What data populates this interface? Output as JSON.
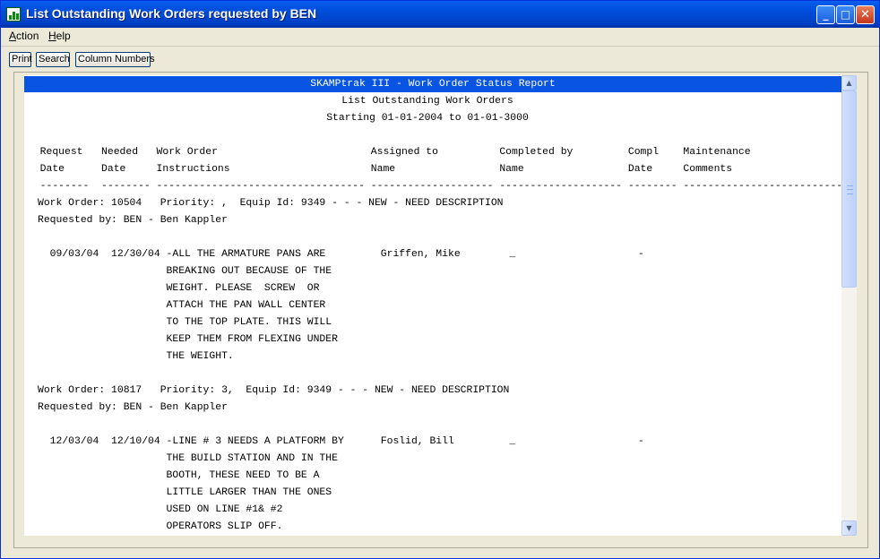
{
  "window": {
    "title": "List Outstanding Work Orders requested by BEN"
  },
  "titlebar_buttons": {
    "minimize": "_",
    "maximize": "□",
    "close": "✕"
  },
  "menu": [
    {
      "label": "Action"
    },
    {
      "label": "Help"
    }
  ],
  "toolbar": {
    "print_label": "Print",
    "search_label": "Search",
    "column_numbers_label": "Column Numbers"
  },
  "report": {
    "header": "SKAMPtrak III - Work Order Status Report",
    "subtitle": "List Outstanding Work Orders",
    "date_range": "Starting 01-01-2004 to 01-01-3000",
    "column_header_line1": "  Request   Needed   Work Order                         Assigned to          Completed by         Compl    Maintenance",
    "column_header_line2": "  Date      Date     Instructions                       Name                 Name                 Date     Comments",
    "separator_line": "  --------  -------- ---------------------------------- -------------------- -------------------- -------- --------------------------",
    "work_orders": [
      {
        "header": "Work Order: 10504   Priority: ,  Equip Id: 9349 - - - NEW - NEED DESCRIPTION",
        "requested_by": "Requested by: BEN - Ben Kappler",
        "lines": [
          "  09/03/04  12/30/04 -ALL THE ARMATURE PANS ARE         Griffen, Mike        _                    -",
          "                     BREAKING OUT BECAUSE OF THE",
          "                     WEIGHT. PLEASE  SCREW  OR",
          "                     ATTACH THE PAN WALL CENTER",
          "                     TO THE TOP PLATE. THIS WILL",
          "                     KEEP THEM FROM FLEXING UNDER",
          "                     THE WEIGHT."
        ]
      },
      {
        "header": "Work Order: 10817   Priority: 3,  Equip Id: 9349 - - - NEW - NEED DESCRIPTION",
        "requested_by": "Requested by: BEN - Ben Kappler",
        "lines": [
          "  12/03/04  12/10/04 -LINE # 3 NEEDS A PLATFORM BY      Foslid, Bill         _                    -",
          "                     THE BUILD STATION AND IN THE",
          "                     BOOTH, THESE NEED TO BE A",
          "                     LITTLE LARGER THAN THE ONES",
          "                     USED ON LINE #1& #2",
          "                     OPERATORS SLIP OFF."
        ]
      }
    ]
  },
  "scrollbar": {
    "up": "▲",
    "down": "▼"
  }
}
